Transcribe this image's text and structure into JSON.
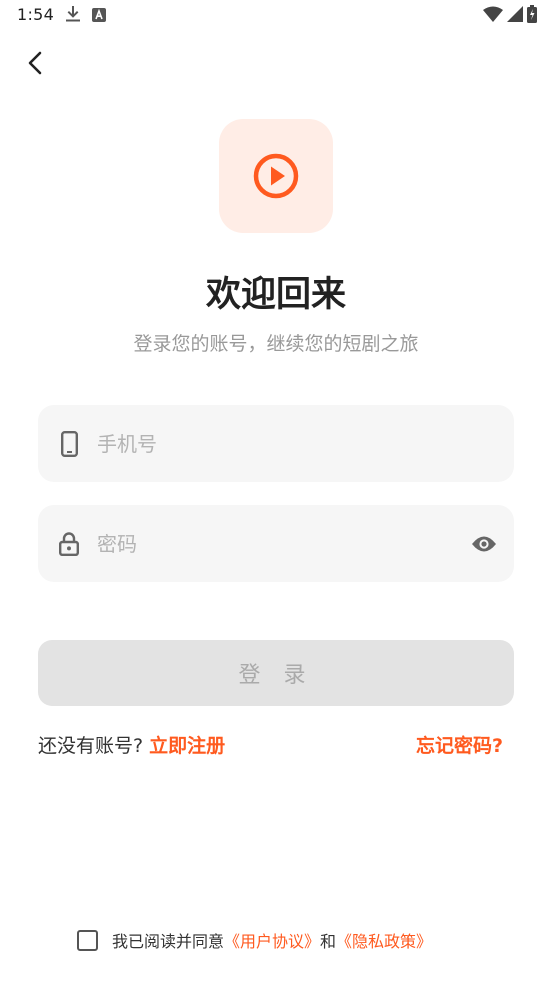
{
  "status_bar": {
    "time": "1:54",
    "left_icons": [
      "download-icon",
      "a-badge-icon"
    ],
    "right_icons": [
      "wifi-icon",
      "cellular-signal-icon",
      "battery-icon"
    ]
  },
  "nav": {
    "back_icon": "chevron-left-icon"
  },
  "logo": {
    "icon": "play-circle-icon",
    "accent": "#ff5a1f",
    "tile_color": "#ffede6"
  },
  "header": {
    "title": "欢迎回来",
    "subtitle": "登录您的账号，继续您的短剧之旅"
  },
  "form": {
    "phone": {
      "placeholder": "手机号",
      "value": "",
      "icon": "phone-icon"
    },
    "password": {
      "placeholder": "密码",
      "value": "",
      "icon": "lock-icon",
      "toggle_icon": "eye-icon"
    },
    "submit_label": "登 录",
    "submit_enabled": false
  },
  "links": {
    "no_account_text": "还没有账号?",
    "register_label": "立即注册",
    "forgot_label": "忘记密码?"
  },
  "agreement": {
    "checked": false,
    "text": "我已阅读并同意",
    "user_agreement": "《用户协议》",
    "and_text": "和",
    "privacy_policy": "《隐私政策》"
  }
}
